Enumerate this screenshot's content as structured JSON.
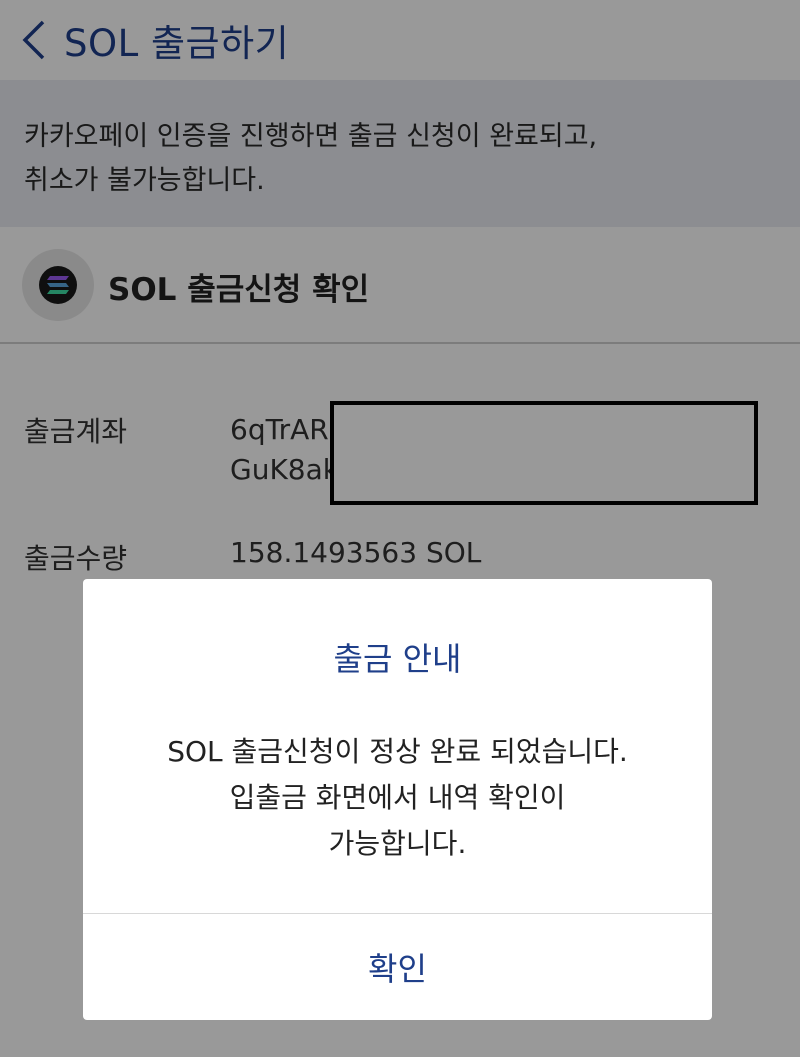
{
  "header": {
    "title": "SOL 출금하기",
    "back_icon": "chevron-left-icon"
  },
  "notice": {
    "line1": "카카오페이 인증을 진행하면 출금 신청이 완료되고,",
    "line2": "취소가 불가능합니다."
  },
  "section": {
    "coin_icon": "solana-logo-icon",
    "title": "SOL 출금신청 확인"
  },
  "details": {
    "account_label": "출금계좌",
    "account_line1": "6qTrAR",
    "account_line2": "GuK8ak",
    "amount_label": "출금수량",
    "amount_value": "158.1493563 SOL"
  },
  "dialog": {
    "title": "출금 안내",
    "message_line1": "SOL 출금신청이 정상 완료 되었습니다.",
    "message_line2": "입출금 화면에서 내역 확인이",
    "message_line3": "가능합니다.",
    "confirm_label": "확인"
  },
  "colors": {
    "accent": "#1f3f8a",
    "notice_bg": "#e9ecf2",
    "overlay": "rgba(0,0,0,0.4)"
  }
}
